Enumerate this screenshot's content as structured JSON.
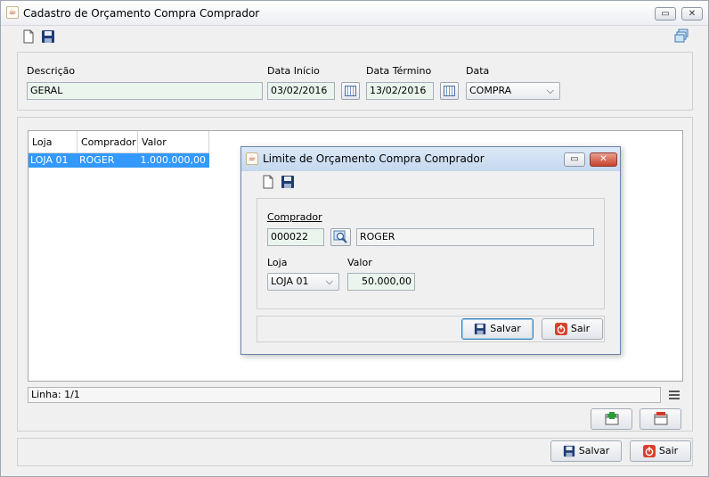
{
  "window": {
    "title": "Cadastro de Orçamento Compra Comprador",
    "restore_icon": "restore-icon",
    "close_icon": "close-icon"
  },
  "toolbar": {
    "new_icon": "new-document-icon",
    "save_icon": "save-disk-icon",
    "windows_icon": "cascade-windows-icon"
  },
  "filter": {
    "descricao_label": "Descrição",
    "descricao_value": "GERAL",
    "data_inicio_label": "Data Início",
    "data_inicio_value": "03/02/2016",
    "data_termino_label": "Data Término",
    "data_termino_value": "13/02/2016",
    "data_label": "Data",
    "data_value": "COMPRA"
  },
  "table": {
    "columns": [
      "Loja",
      "Comprador",
      "Valor"
    ],
    "rows": [
      {
        "loja": "LOJA 01",
        "comprador": "ROGER",
        "valor": "1.000.000,00"
      }
    ]
  },
  "dialog": {
    "title": "Limite de Orçamento Compra Comprador",
    "comprador_label": "Comprador",
    "comprador_code": "000022",
    "comprador_name": "ROGER",
    "loja_label": "Loja",
    "loja_value": "LOJA 01",
    "valor_label": "Valor",
    "valor_value": "50.000,00",
    "salvar_label": "Salvar",
    "sair_label": "Sair"
  },
  "status": {
    "linha_text": "Linha: 1/1"
  },
  "footer": {
    "salvar_label": "Salvar",
    "sair_label": "Sair"
  },
  "colors": {
    "selection": "#3399ff",
    "field_bg": "#e9f5ed",
    "window_bg": "#f0f0f0"
  }
}
